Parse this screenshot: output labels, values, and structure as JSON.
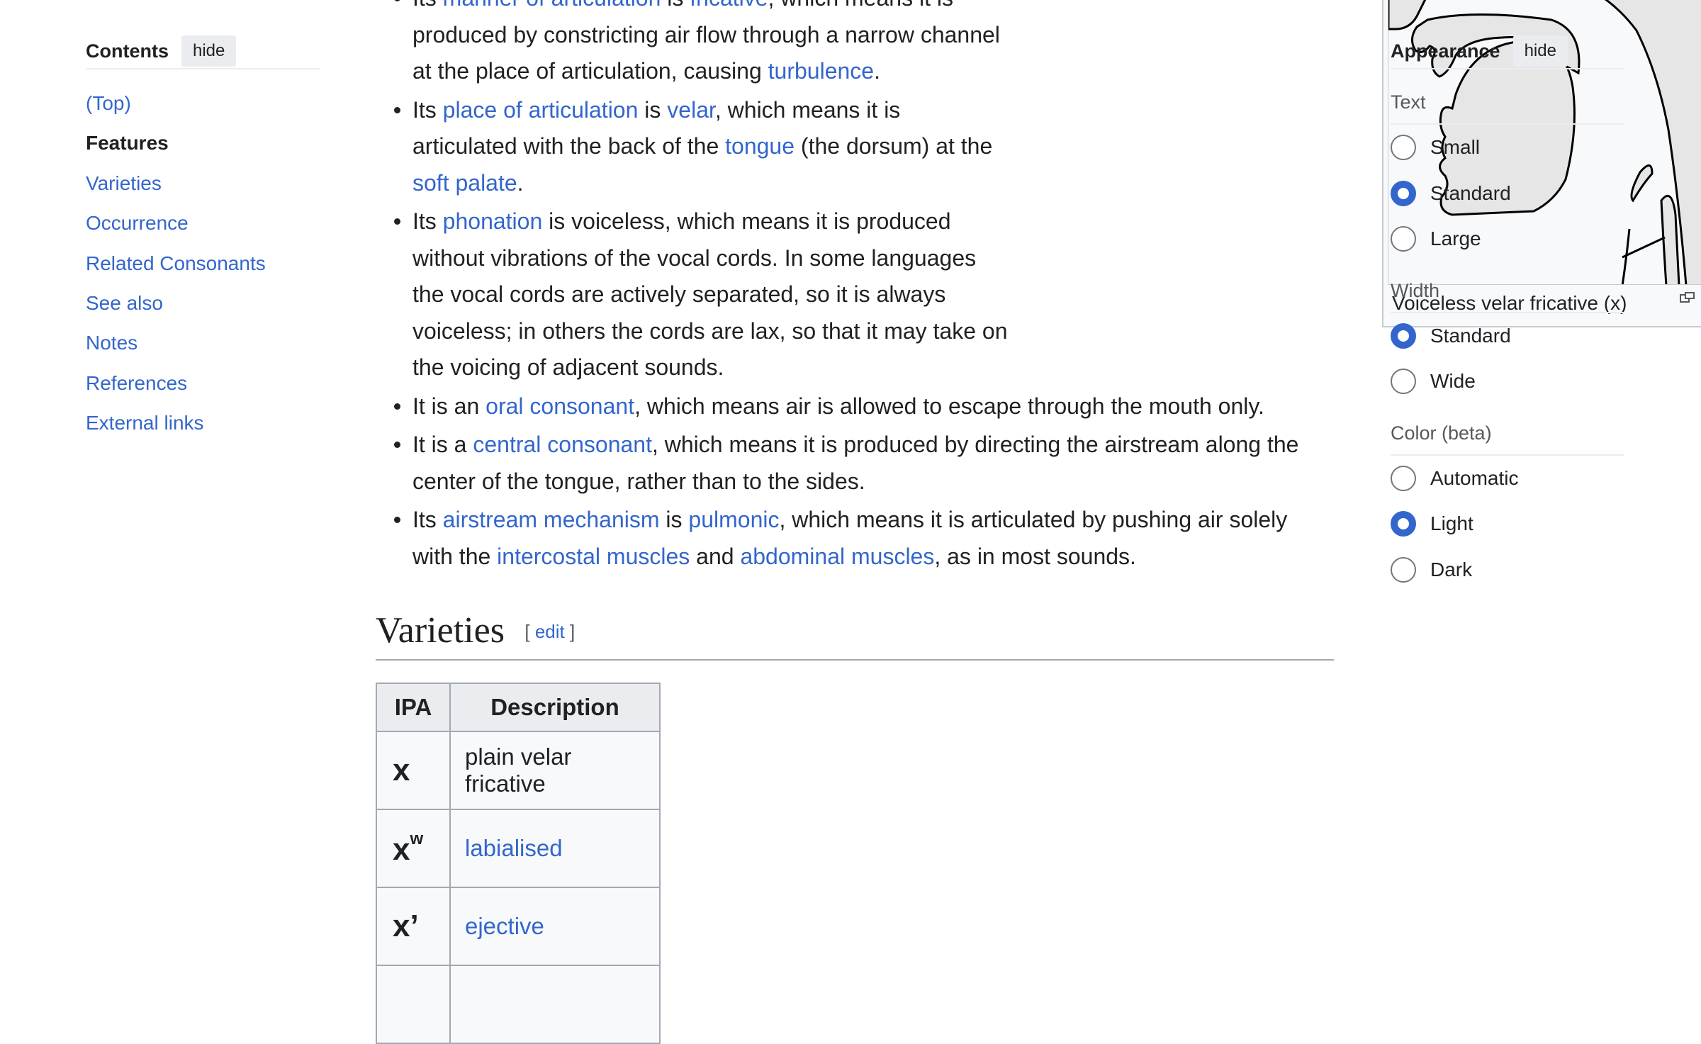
{
  "toc": {
    "title": "Contents",
    "hide_label": "hide",
    "items": [
      "(Top)",
      "Features",
      "Varieties",
      "Occurrence",
      "Related Consonants",
      "See also",
      "Notes",
      "References",
      "External links"
    ]
  },
  "appearance": {
    "title": "Appearance",
    "hide_label": "hide",
    "groups": [
      {
        "label": "Text",
        "options": [
          "Small",
          "Standard",
          "Large"
        ],
        "selected": "Standard"
      },
      {
        "label": "Width",
        "options": [
          "Standard",
          "Wide"
        ],
        "selected": "Standard"
      },
      {
        "label": "Color (beta)",
        "options": [
          "Automatic",
          "Light",
          "Dark"
        ],
        "selected": "Light"
      }
    ]
  },
  "features": {
    "b1": {
      "t1": "Its ",
      "l1": "manner of articulation",
      "t2": " is ",
      "l2": "fricative",
      "t3": ", which means it is produced by constricting air flow through a narrow channel at the place of articulation, causing ",
      "l3": "turbulence",
      "t4": "."
    },
    "b2": {
      "t1": "Its ",
      "l1": "place of articulation",
      "t2": " is ",
      "l2": "velar",
      "t3": ", which means it is articulated with the back of the ",
      "l3": "tongue",
      "t4": " (the dorsum) at the ",
      "l4": "soft palate",
      "t5": "."
    },
    "b3": {
      "t1": "Its ",
      "l1": "phonation",
      "t2": " is voiceless, which means it is produced without vibrations of the vocal cords. In some languages the vocal cords are actively separated, so it is always voiceless; in others the cords are lax, so that it may take on the voicing of adjacent sounds."
    },
    "b4": {
      "t1": "It is an ",
      "l1": "oral consonant",
      "t2": ", which means air is allowed to escape through the mouth only."
    },
    "b5": {
      "t1": "It is a ",
      "l1": "central consonant",
      "t2": ", which means it is produced by directing the airstream along the center of the tongue, rather than to the sides."
    },
    "b6": {
      "t1": "Its ",
      "l1": "airstream mechanism",
      "t2": " is ",
      "l2": "pulmonic",
      "t3": ", which means it is articulated by pushing air solely with the ",
      "l3": "intercostal muscles",
      "t4": " and ",
      "l4": "abdominal muscles",
      "t5": ", as in most sounds."
    }
  },
  "figure": {
    "caption": "Voiceless velar fricative (x)",
    "enlarge_icon": "magnify-clip-icon"
  },
  "varieties": {
    "heading": "Varieties",
    "edit_open": "[ ",
    "edit_label": "edit",
    "edit_close": " ]",
    "table": {
      "headers": [
        "IPA",
        "Description"
      ],
      "rows": [
        {
          "ipa": "x",
          "ipa_sup": "",
          "desc": "plain velar fricative"
        },
        {
          "ipa": "x",
          "ipa_sup": "w",
          "desc": "labialised"
        },
        {
          "ipa": "x’",
          "ipa_sup": "",
          "desc": "ejective"
        }
      ]
    }
  }
}
